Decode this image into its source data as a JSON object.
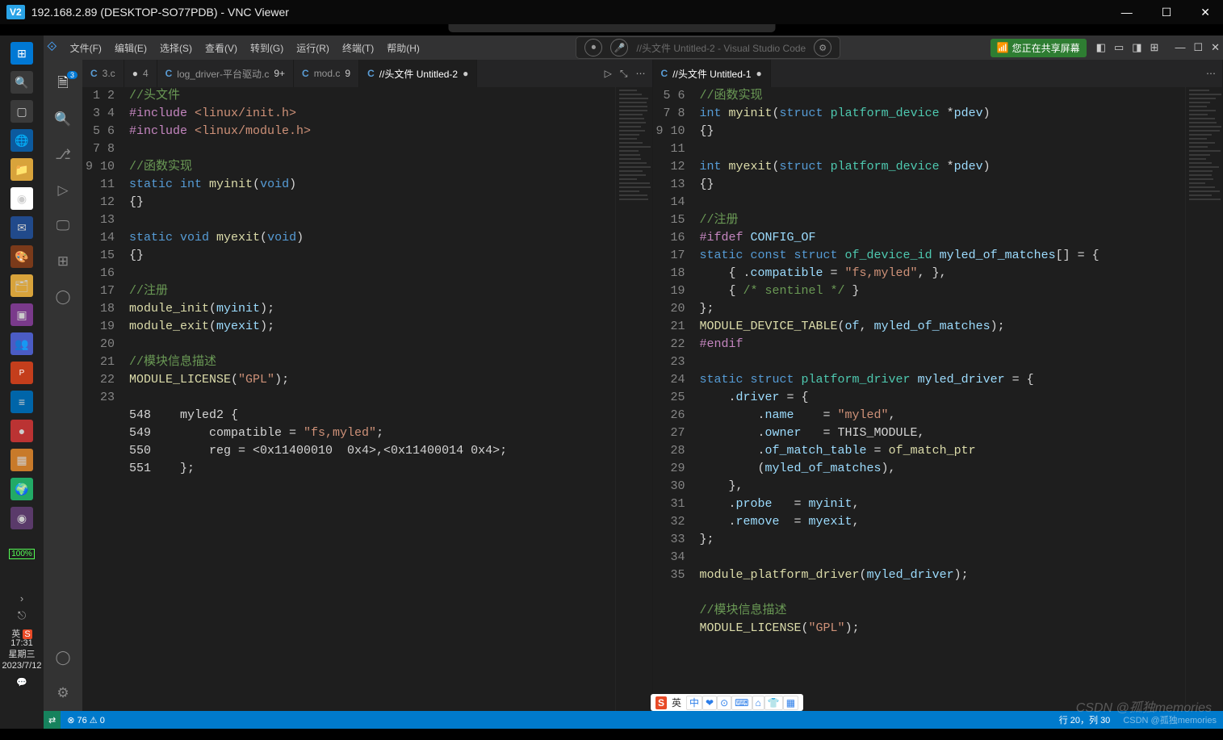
{
  "vnc": {
    "title": "192.168.2.89 (DESKTOP-SO77PDB) - VNC Viewer",
    "logo": "V2"
  },
  "win": {
    "battery": "100%",
    "time": "17:31",
    "weekday": "星期三",
    "date": "2023/7/12"
  },
  "menu": {
    "items": [
      "文件(F)",
      "编辑(E)",
      "选择(S)",
      "查看(V)",
      "转到(G)",
      "运行(R)",
      "终端(T)",
      "帮助(H)"
    ],
    "center": "//头文件 Untitled-2 - Visual Studio Code",
    "share": "您正在共享屏幕"
  },
  "activity_badge": "3",
  "tabs_left": [
    {
      "icon": "C",
      "label": "3.c",
      "trail": ""
    },
    {
      "icon": "●",
      "label": "4",
      "trail": ""
    },
    {
      "icon": "C",
      "label": "log_driver-平台驱动.c",
      "trail": "9+"
    },
    {
      "icon": "C",
      "label": "mod.c",
      "trail": "9"
    },
    {
      "icon": "C",
      "label": "//头文件 Untitled-2",
      "trail": "●",
      "active": true
    }
  ],
  "tabs_right": [
    {
      "icon": "C",
      "label": "//头文件 Untitled-1",
      "trail": "●",
      "active": true
    }
  ],
  "code_left": {
    "start": 1,
    "lines": [
      [
        {
          "t": "//头文件",
          "c": "cm"
        }
      ],
      [
        {
          "t": "#include ",
          "c": "pp"
        },
        {
          "t": "<linux/init.h>",
          "c": "st"
        }
      ],
      [
        {
          "t": "#include ",
          "c": "pp"
        },
        {
          "t": "<linux/module.h>",
          "c": "st"
        }
      ],
      [],
      [
        {
          "t": "//函数实现",
          "c": "cm"
        }
      ],
      [
        {
          "t": "static ",
          "c": "kw"
        },
        {
          "t": "int ",
          "c": "kw"
        },
        {
          "t": "myinit",
          "c": "fn"
        },
        {
          "t": "(",
          "c": ""
        },
        {
          "t": "void",
          "c": "kw"
        },
        {
          "t": ")",
          "c": ""
        }
      ],
      [
        {
          "t": "{}",
          "c": ""
        }
      ],
      [],
      [
        {
          "t": "static ",
          "c": "kw"
        },
        {
          "t": "void ",
          "c": "kw"
        },
        {
          "t": "myexit",
          "c": "fn"
        },
        {
          "t": "(",
          "c": ""
        },
        {
          "t": "void",
          "c": "kw"
        },
        {
          "t": ")",
          "c": ""
        }
      ],
      [
        {
          "t": "{}",
          "c": ""
        }
      ],
      [],
      [
        {
          "t": "//注册",
          "c": "cm"
        }
      ],
      [
        {
          "t": "module_init",
          "c": "fn"
        },
        {
          "t": "(",
          "c": ""
        },
        {
          "t": "myinit",
          "c": "id"
        },
        {
          "t": ");",
          "c": ""
        }
      ],
      [
        {
          "t": "module_exit",
          "c": "fn"
        },
        {
          "t": "(",
          "c": ""
        },
        {
          "t": "myexit",
          "c": "id"
        },
        {
          "t": ");",
          "c": ""
        }
      ],
      [],
      [
        {
          "t": "//模块信息描述",
          "c": "cm"
        }
      ],
      [
        {
          "t": "MODULE_LICENSE",
          "c": "fn"
        },
        {
          "t": "(",
          "c": ""
        },
        {
          "t": "\"GPL\"",
          "c": "st"
        },
        {
          "t": ");",
          "c": ""
        }
      ],
      [],
      [
        {
          "t": "548    myled2 ",
          "c": ""
        },
        {
          "t": "{",
          "c": ""
        }
      ],
      [
        {
          "t": "549        compatible = ",
          "c": ""
        },
        {
          "t": "\"fs,myled\"",
          "c": "st"
        },
        {
          "t": ";",
          "c": ""
        }
      ],
      [
        {
          "t": "550        reg = <0x11400010  0x4>,<0x11400014 0x4>;",
          "c": ""
        }
      ],
      [
        {
          "t": "551    ",
          "c": ""
        },
        {
          "t": "}",
          "c": ""
        },
        {
          "t": ";",
          "c": ""
        }
      ],
      []
    ]
  },
  "code_right": {
    "start": 5,
    "lines": [
      [
        {
          "t": "//函数实现",
          "c": "cm"
        }
      ],
      [
        {
          "t": "int ",
          "c": "kw"
        },
        {
          "t": "myinit",
          "c": "fn"
        },
        {
          "t": "(",
          "c": ""
        },
        {
          "t": "struct ",
          "c": "kw"
        },
        {
          "t": "platform_device ",
          "c": "ty"
        },
        {
          "t": "*",
          "c": ""
        },
        {
          "t": "pdev",
          "c": "id"
        },
        {
          "t": ")",
          "c": ""
        }
      ],
      [
        {
          "t": "{}",
          "c": ""
        }
      ],
      [],
      [
        {
          "t": "int ",
          "c": "kw"
        },
        {
          "t": "myexit",
          "c": "fn"
        },
        {
          "t": "(",
          "c": ""
        },
        {
          "t": "struct ",
          "c": "kw"
        },
        {
          "t": "platform_device ",
          "c": "ty"
        },
        {
          "t": "*",
          "c": ""
        },
        {
          "t": "pdev",
          "c": "id"
        },
        {
          "t": ")",
          "c": ""
        }
      ],
      [
        {
          "t": "{}",
          "c": ""
        }
      ],
      [],
      [
        {
          "t": "//注册",
          "c": "cm"
        }
      ],
      [
        {
          "t": "#ifdef ",
          "c": "pp"
        },
        {
          "t": "CONFIG_OF",
          "c": "id"
        }
      ],
      [
        {
          "t": "static ",
          "c": "kw"
        },
        {
          "t": "const ",
          "c": "kw"
        },
        {
          "t": "struct ",
          "c": "kw"
        },
        {
          "t": "of_device_id ",
          "c": "ty"
        },
        {
          "t": "myled_of_matches",
          "c": "id"
        },
        {
          "t": "[] = {",
          "c": ""
        }
      ],
      [
        {
          "t": "    { .",
          "c": ""
        },
        {
          "t": "compatible",
          "c": "id"
        },
        {
          "t": " = ",
          "c": ""
        },
        {
          "t": "\"fs,myled\"",
          "c": "st"
        },
        {
          "t": ", },",
          "c": ""
        }
      ],
      [
        {
          "t": "    { ",
          "c": ""
        },
        {
          "t": "/* sentinel */",
          "c": "cm"
        },
        {
          "t": " }",
          "c": ""
        }
      ],
      [
        {
          "t": "};",
          "c": ""
        }
      ],
      [
        {
          "t": "MODULE_DEVICE_TABLE",
          "c": "fn"
        },
        {
          "t": "(",
          "c": ""
        },
        {
          "t": "of",
          "c": "id"
        },
        {
          "t": ", ",
          "c": ""
        },
        {
          "t": "myled_of_matches",
          "c": "id"
        },
        {
          "t": ");",
          "c": ""
        }
      ],
      [
        {
          "t": "#endif",
          "c": "pp"
        }
      ],
      [],
      [
        {
          "t": "static ",
          "c": "kw"
        },
        {
          "t": "struct ",
          "c": "kw"
        },
        {
          "t": "platform_driver ",
          "c": "ty"
        },
        {
          "t": "myled_driver",
          "c": "id"
        },
        {
          "t": " = {",
          "c": ""
        }
      ],
      [
        {
          "t": "    .",
          "c": ""
        },
        {
          "t": "driver",
          "c": "id"
        },
        {
          "t": " = {",
          "c": ""
        }
      ],
      [
        {
          "t": "        .",
          "c": ""
        },
        {
          "t": "name",
          "c": "id"
        },
        {
          "t": "    = ",
          "c": ""
        },
        {
          "t": "\"myled\"",
          "c": "st"
        },
        {
          "t": ",",
          "c": ""
        }
      ],
      [
        {
          "t": "        .",
          "c": ""
        },
        {
          "t": "owner",
          "c": "id"
        },
        {
          "t": "   = THIS_MODULE,",
          "c": ""
        }
      ],
      [
        {
          "t": "        .",
          "c": ""
        },
        {
          "t": "of_match_table",
          "c": "id"
        },
        {
          "t": " = ",
          "c": ""
        },
        {
          "t": "of_match_ptr",
          "c": "fn"
        }
      ],
      [
        {
          "t": "        (",
          "c": ""
        },
        {
          "t": "myled_of_matches",
          "c": "id"
        },
        {
          "t": "),",
          "c": ""
        }
      ],
      [
        {
          "t": "    },",
          "c": ""
        }
      ],
      [
        {
          "t": "    .",
          "c": ""
        },
        {
          "t": "probe",
          "c": "id"
        },
        {
          "t": "   = ",
          "c": ""
        },
        {
          "t": "myinit",
          "c": "id"
        },
        {
          "t": ",",
          "c": ""
        }
      ],
      [
        {
          "t": "    .",
          "c": ""
        },
        {
          "t": "remove",
          "c": "id"
        },
        {
          "t": "  = ",
          "c": ""
        },
        {
          "t": "myexit",
          "c": "id"
        },
        {
          "t": ",",
          "c": ""
        }
      ],
      [
        {
          "t": "};",
          "c": ""
        }
      ],
      [],
      [
        {
          "t": "module_platform_driver",
          "c": "fn"
        },
        {
          "t": "(",
          "c": ""
        },
        {
          "t": "myled_driver",
          "c": "id"
        },
        {
          "t": ");",
          "c": ""
        }
      ],
      [],
      [
        {
          "t": "//模块信息描述",
          "c": "cm"
        }
      ],
      [
        {
          "t": "MODULE_LICENSE",
          "c": "fn"
        },
        {
          "t": "(",
          "c": ""
        },
        {
          "t": "\"GPL\"",
          "c": "st"
        },
        {
          "t": ");",
          "c": ""
        }
      ]
    ]
  },
  "status": {
    "remote_icon": "⇄",
    "problems": "⊗ 76 ⚠ 0",
    "pos": "行 20，列 30",
    "spaces": "",
    "misc": "CSDN @孤独memories"
  },
  "ime": {
    "lang": "英",
    "items": [
      "中",
      "❤",
      "⊙",
      "⌨",
      "⌂",
      "👕",
      "▦"
    ]
  }
}
